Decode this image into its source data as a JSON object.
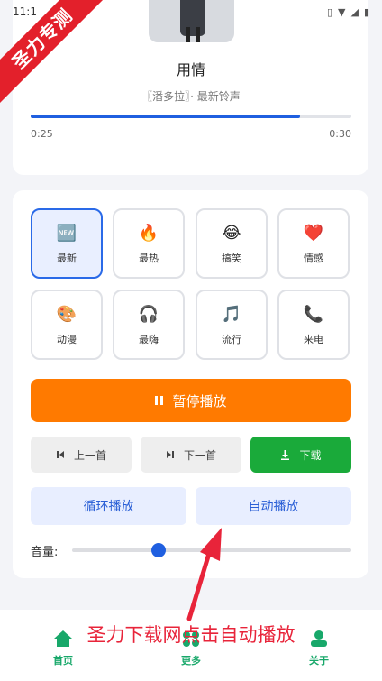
{
  "status": {
    "time": "11:1"
  },
  "watermark": {
    "text": "圣力专测"
  },
  "player": {
    "song_title": "用情",
    "song_subtitle": "〖潘多拉〗· 最新铃声",
    "progress_fraction": 0.84,
    "time_current": "0:25",
    "time_total": "0:30"
  },
  "categories": [
    {
      "label": "最新",
      "icon": "new-icon",
      "glyph": "🆕",
      "active": true
    },
    {
      "label": "最热",
      "icon": "fire-icon",
      "glyph": "🔥",
      "active": false
    },
    {
      "label": "搞笑",
      "icon": "laughing-face-icon",
      "glyph": "😂",
      "active": false
    },
    {
      "label": "情感",
      "icon": "heart-icon",
      "glyph": "❤️",
      "active": false
    },
    {
      "label": "动漫",
      "icon": "palette-icon",
      "glyph": "🎨",
      "active": false
    },
    {
      "label": "最嗨",
      "icon": "headphones-icon",
      "glyph": "🎧",
      "active": false
    },
    {
      "label": "流行",
      "icon": "music-note-icon",
      "glyph": "🎵",
      "active": false
    },
    {
      "label": "来电",
      "icon": "phone-icon",
      "glyph": "📞",
      "active": false
    }
  ],
  "controls": {
    "pause_label": "暂停播放",
    "prev_label": "上一首",
    "next_label": "下一首",
    "download_label": "下载",
    "loop_label": "循环播放",
    "auto_label": "自动播放",
    "volume_label": "音量:",
    "volume_fraction": 0.31
  },
  "tabs": [
    {
      "label": "首页",
      "icon": "home-icon"
    },
    {
      "label": "更多",
      "icon": "more-icon"
    },
    {
      "label": "关于",
      "icon": "about-icon"
    }
  ],
  "overlay": {
    "text": "圣力下载网点击自动播放"
  },
  "colors": {
    "accent_blue": "#1f5fe0",
    "pause_orange": "#ff7a00",
    "download_green": "#1aaa3a",
    "tab_green": "#18a86a",
    "overlay_red": "#e8243a"
  }
}
